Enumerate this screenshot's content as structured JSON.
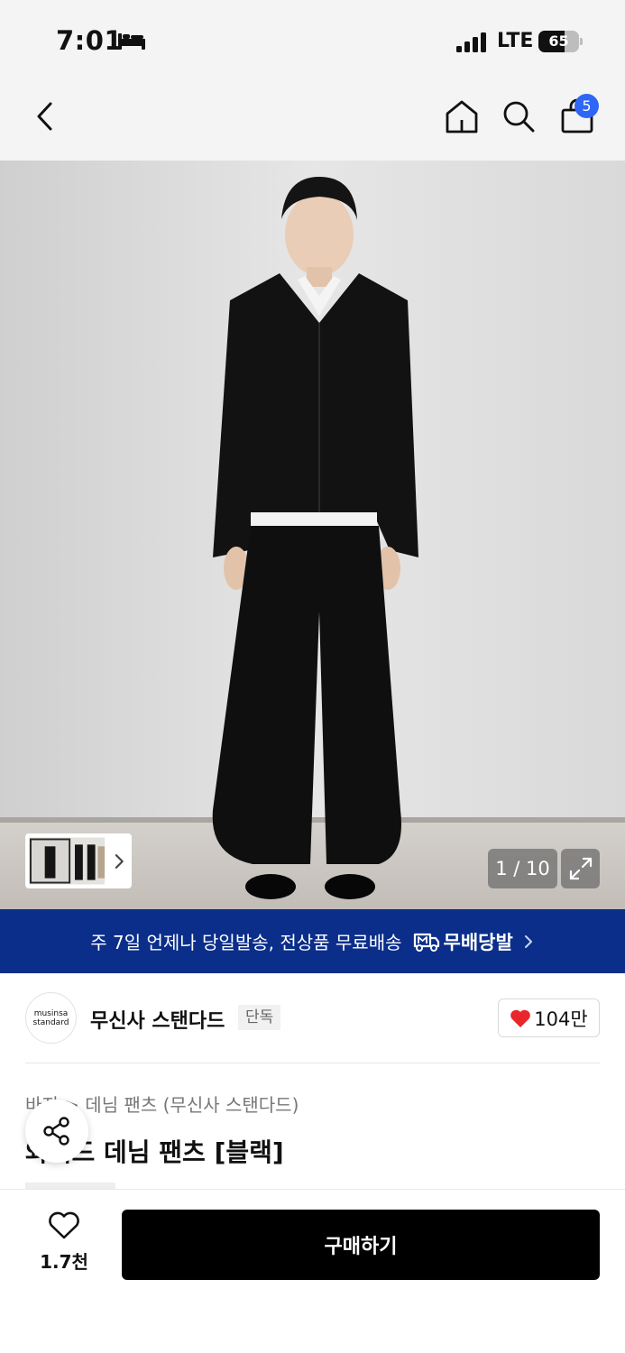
{
  "status_bar": {
    "time": "7:01",
    "network": "LTE",
    "battery_level": 65,
    "battery_text": "65",
    "icons": [
      "bed-icon",
      "signal-icon",
      "battery-icon"
    ]
  },
  "nav": {
    "icons": [
      "back-icon",
      "home-icon",
      "search-icon",
      "cart-icon"
    ],
    "cart_badge": "5",
    "badge_color": "#2e66f5"
  },
  "gallery": {
    "counter": "1 / 10",
    "icons": [
      "chevron-right-icon",
      "expand-icon"
    ]
  },
  "banner": {
    "text": "주 7일 언제나 당일발송, 전상품 무료배송",
    "logo_text": "무배당발",
    "color": "#0a2e8a",
    "icons": [
      "delivery-truck-icon",
      "chevron-right-icon"
    ]
  },
  "brand": {
    "logo_line1": "musinsa",
    "logo_line2": "standard",
    "name": "무신사 스탠다드",
    "tag": "단독",
    "like_count": "104만",
    "heart_color": "#e8262b"
  },
  "product": {
    "breadcrumb": [
      "바지",
      "데님 팬츠 (무신사 스탠다드)"
    ],
    "title": "와이드 데님 팬츠 [블랙]",
    "icons": [
      "share-icon"
    ]
  },
  "bottom": {
    "wish_count": "1.7천",
    "buy_label": "구매하기",
    "icons": [
      "heart-outline-icon"
    ]
  }
}
